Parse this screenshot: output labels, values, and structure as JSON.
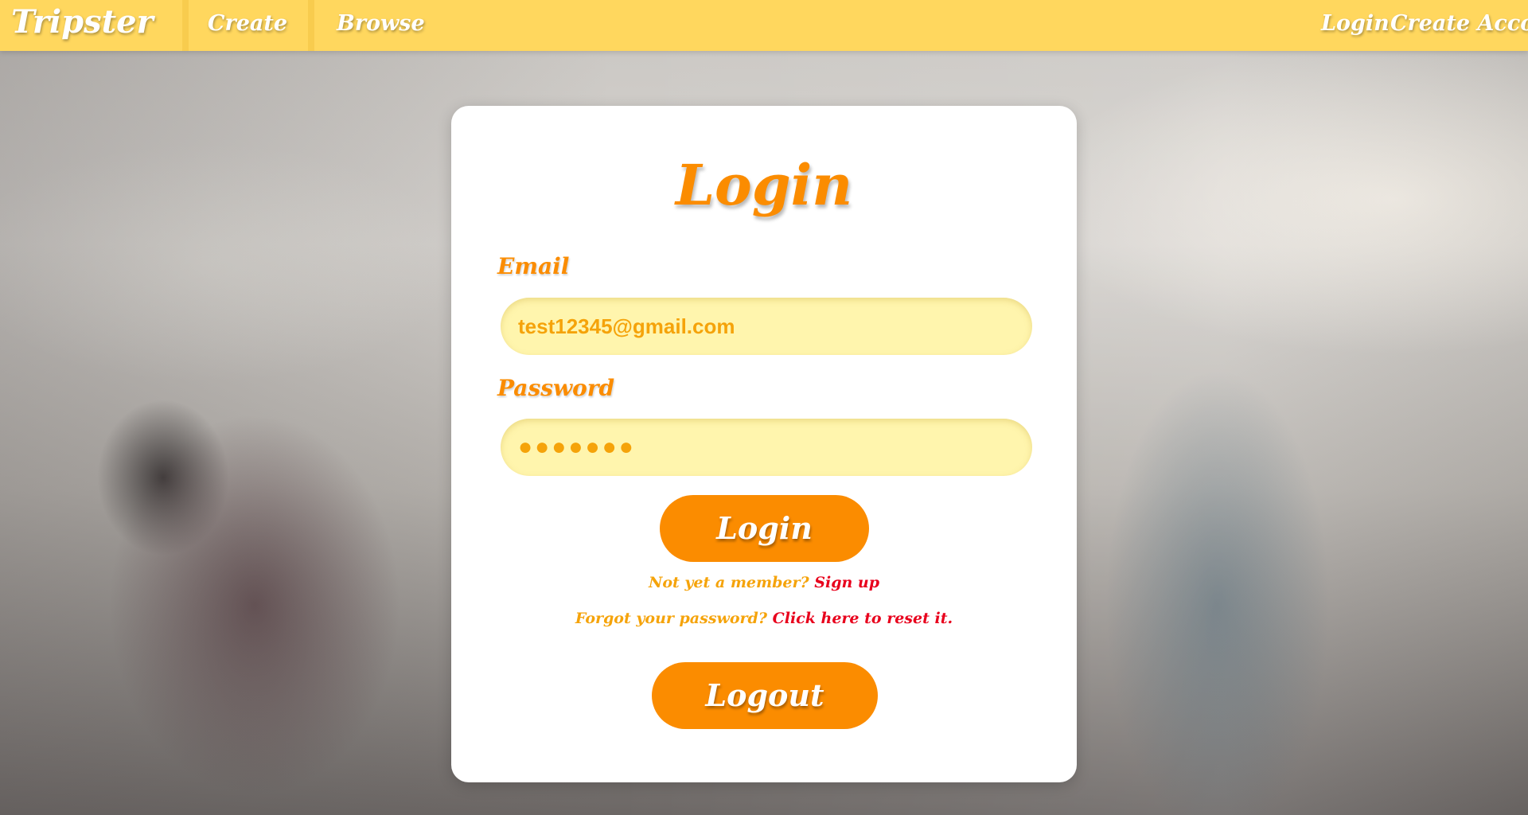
{
  "nav": {
    "brand": "Tripster",
    "create": "Create",
    "browse": "Browse",
    "login": "Login",
    "create_account": "Create Account"
  },
  "card": {
    "title": "Login",
    "email_label": "Email",
    "email_value": "test12345@gmail.com",
    "password_label": "Password",
    "password_mask": "●●●●●●●",
    "login_button": "Login",
    "not_member_text": "Not yet a member?",
    "sign_up_link": "Sign up",
    "forgot_text": "Forgot your password?",
    "reset_link": "Click here to reset it.",
    "logout_button": "Logout"
  },
  "colors": {
    "navbar": "#ffd75e",
    "accent": "#fb8c00",
    "field_bg": "#fff5ad",
    "link": "#e8001c"
  }
}
